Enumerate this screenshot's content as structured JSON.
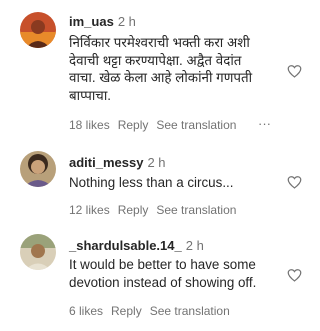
{
  "comments": [
    {
      "username": "im_uas",
      "time": "2 h",
      "text": "निर्विकार परमेश्वराची भक्ती करा अशी देवाची थट्टा करण्यापेक्षा. अद्वैत वेदांत वाचा. खेळ केला आहे लोकांनी गणपती बाप्पाचा.",
      "likes": "18 likes",
      "reply": "Reply",
      "translation": "See translation",
      "more": "···"
    },
    {
      "username": "aditi_messy",
      "time": "2 h",
      "text": "Nothing less than a circus...",
      "likes": "12 likes",
      "reply": "Reply",
      "translation": "See translation"
    },
    {
      "username": "_shardulsable.14_",
      "time": "2 h",
      "text": "It would be better to have some devotion instead of showing off.",
      "likes": "6 likes",
      "reply": "Reply",
      "translation": "See translation"
    }
  ],
  "icons": {
    "avatar": "avatar-icon",
    "like": "heart-icon",
    "more": "more-icon"
  }
}
